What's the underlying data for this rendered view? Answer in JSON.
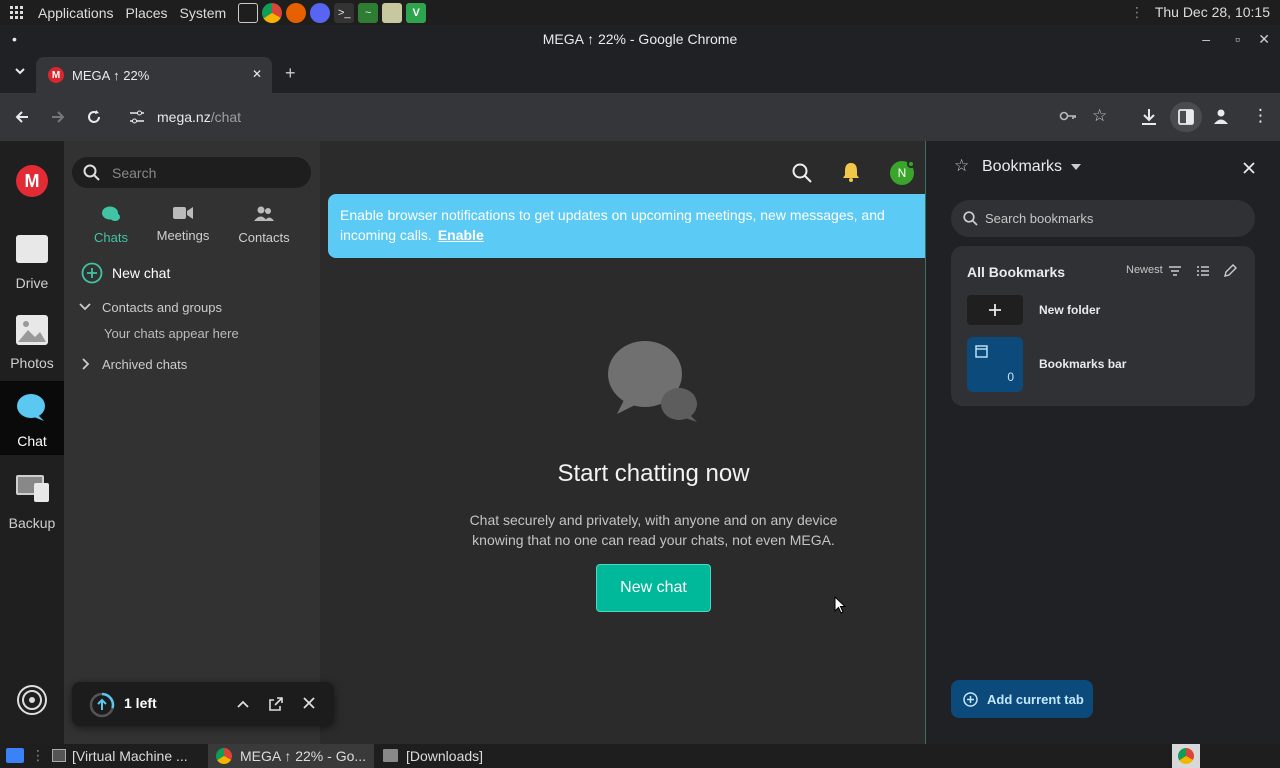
{
  "os_panel": {
    "menus": [
      "Applications",
      "Places",
      "System"
    ],
    "clock": "Thu Dec 28, 10:15"
  },
  "window": {
    "title": "MEGA ↑ 22% - Google Chrome"
  },
  "tab": {
    "title": "MEGA ↑ 22%",
    "favicon_letter": "M"
  },
  "address": {
    "host": "mega.nz",
    "path": "/chat"
  },
  "mega": {
    "logo_letter": "M",
    "rail": [
      {
        "label": "Drive"
      },
      {
        "label": "Photos"
      },
      {
        "label": "Chat"
      },
      {
        "label": "Backup"
      }
    ],
    "search_placeholder": "Search",
    "side_tabs": [
      "Chats",
      "Meetings",
      "Contacts"
    ],
    "new_chat_label": "New chat",
    "contacts_groups_label": "Contacts and groups",
    "empty_hint": "Your chats appear here",
    "archived_label": "Archived chats",
    "avatar_letter": "N",
    "banner_text": "Enable browser notifications to get updates on upcoming meetings, new messages, and incoming calls.",
    "banner_link": "Enable",
    "empty_title": "Start chatting now",
    "empty_desc_line1": "Chat securely and privately, with anyone and on any device",
    "empty_desc_line2": "knowing that no one can read your chats, not even MEGA.",
    "new_chat_button": "New chat",
    "transfer_label": "1 left",
    "accent": "#00b89a",
    "banner_color": "#5bcaf4"
  },
  "bookmarks": {
    "title": "Bookmarks",
    "search_placeholder": "Search bookmarks",
    "all_label": "All Bookmarks",
    "sort_label": "Newest",
    "new_folder": "New folder",
    "bar_label": "Bookmarks bar",
    "bar_count": "0",
    "add_tab": "Add current tab"
  },
  "taskbar": {
    "items": [
      "[Virtual Machine ...",
      "MEGA ↑ 22% - Go...",
      "[Downloads]"
    ]
  }
}
